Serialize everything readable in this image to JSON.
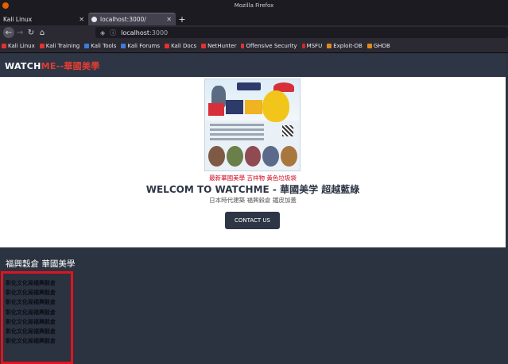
{
  "window": {
    "title": "Mozilla Firefox"
  },
  "tabs": [
    {
      "label": "Kali Linux",
      "active": false
    },
    {
      "label": "localhost:3000/",
      "active": true
    }
  ],
  "url": {
    "host": "localhost",
    "port": ":3000"
  },
  "bookmarks": [
    {
      "label": "Kali Linux",
      "icon": "kali-icon"
    },
    {
      "label": "Kali Training",
      "icon": "kali-icon"
    },
    {
      "label": "Kali Tools",
      "icon": "kali-icon"
    },
    {
      "label": "Kali Forums",
      "icon": "kali-icon"
    },
    {
      "label": "Kali Docs",
      "icon": "kali-icon"
    },
    {
      "label": "NetHunter",
      "icon": "kali-icon"
    },
    {
      "label": "Offensive Security",
      "icon": "offsec-icon"
    },
    {
      "label": "MSFU",
      "icon": "msfu-icon"
    },
    {
      "label": "Exploit-DB",
      "icon": "exploitdb-icon"
    },
    {
      "label": "GHDB",
      "icon": "exploitdb-icon"
    }
  ],
  "site": {
    "brand_white": "WATCH",
    "brand_red": "ME--華國美學",
    "promo_link": "最新華國美學 吉祥物 黃色垃圾袋",
    "hero_title": "WELCOM TO WATCHME - 華國美学 超越藍綠",
    "hero_sub": "日本時代建築 福興穀倉 鐵皮加蓋",
    "contact_label": "CONTACT US",
    "section_title": "福興穀倉 華國美學",
    "list_items": [
      "彰化文化局福興穀倉",
      "彰化文化局福興穀倉",
      "彰化文化局福興穀倉",
      "彰化文化局福興穀倉",
      "彰化文化局福興穀倉",
      "彰化文化局福興穀倉",
      "彰化文化局福興穀倉"
    ]
  },
  "colors": {
    "header_bg": "#2e3646",
    "accent_red": "#e03c31",
    "link_red": "#d0021b",
    "section_bg": "#2b3240"
  }
}
